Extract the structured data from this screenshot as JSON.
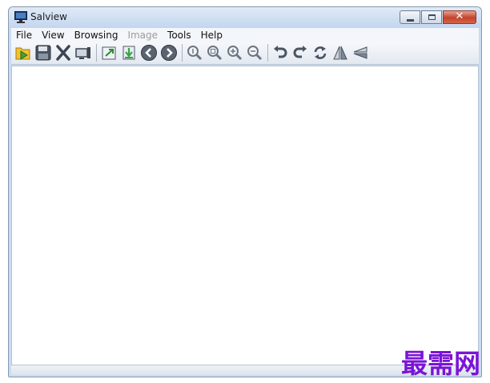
{
  "window": {
    "title": "Salview"
  },
  "menu": [
    {
      "label": "File",
      "enabled": true
    },
    {
      "label": "View",
      "enabled": true
    },
    {
      "label": "Browsing",
      "enabled": true
    },
    {
      "label": "Image",
      "enabled": false
    },
    {
      "label": "Tools",
      "enabled": true
    },
    {
      "label": "Help",
      "enabled": true
    }
  ],
  "toolbar_icons": [
    "open-folder-icon",
    "save-icon",
    "delete-icon",
    "slideshow-icon",
    "export-icon",
    "import-icon",
    "previous-icon",
    "next-icon",
    "zoom-actual-icon",
    "zoom-fit-icon",
    "zoom-in-icon",
    "zoom-out-icon",
    "rotate-left-icon",
    "rotate-right-icon",
    "refresh-icon",
    "flip-horizontal-icon",
    "flip-vertical-icon"
  ],
  "watermark": "最需网",
  "colors": {
    "frame": "#c9dcf2",
    "close_button": "#c4432c",
    "watermark": "#7a14d6"
  }
}
